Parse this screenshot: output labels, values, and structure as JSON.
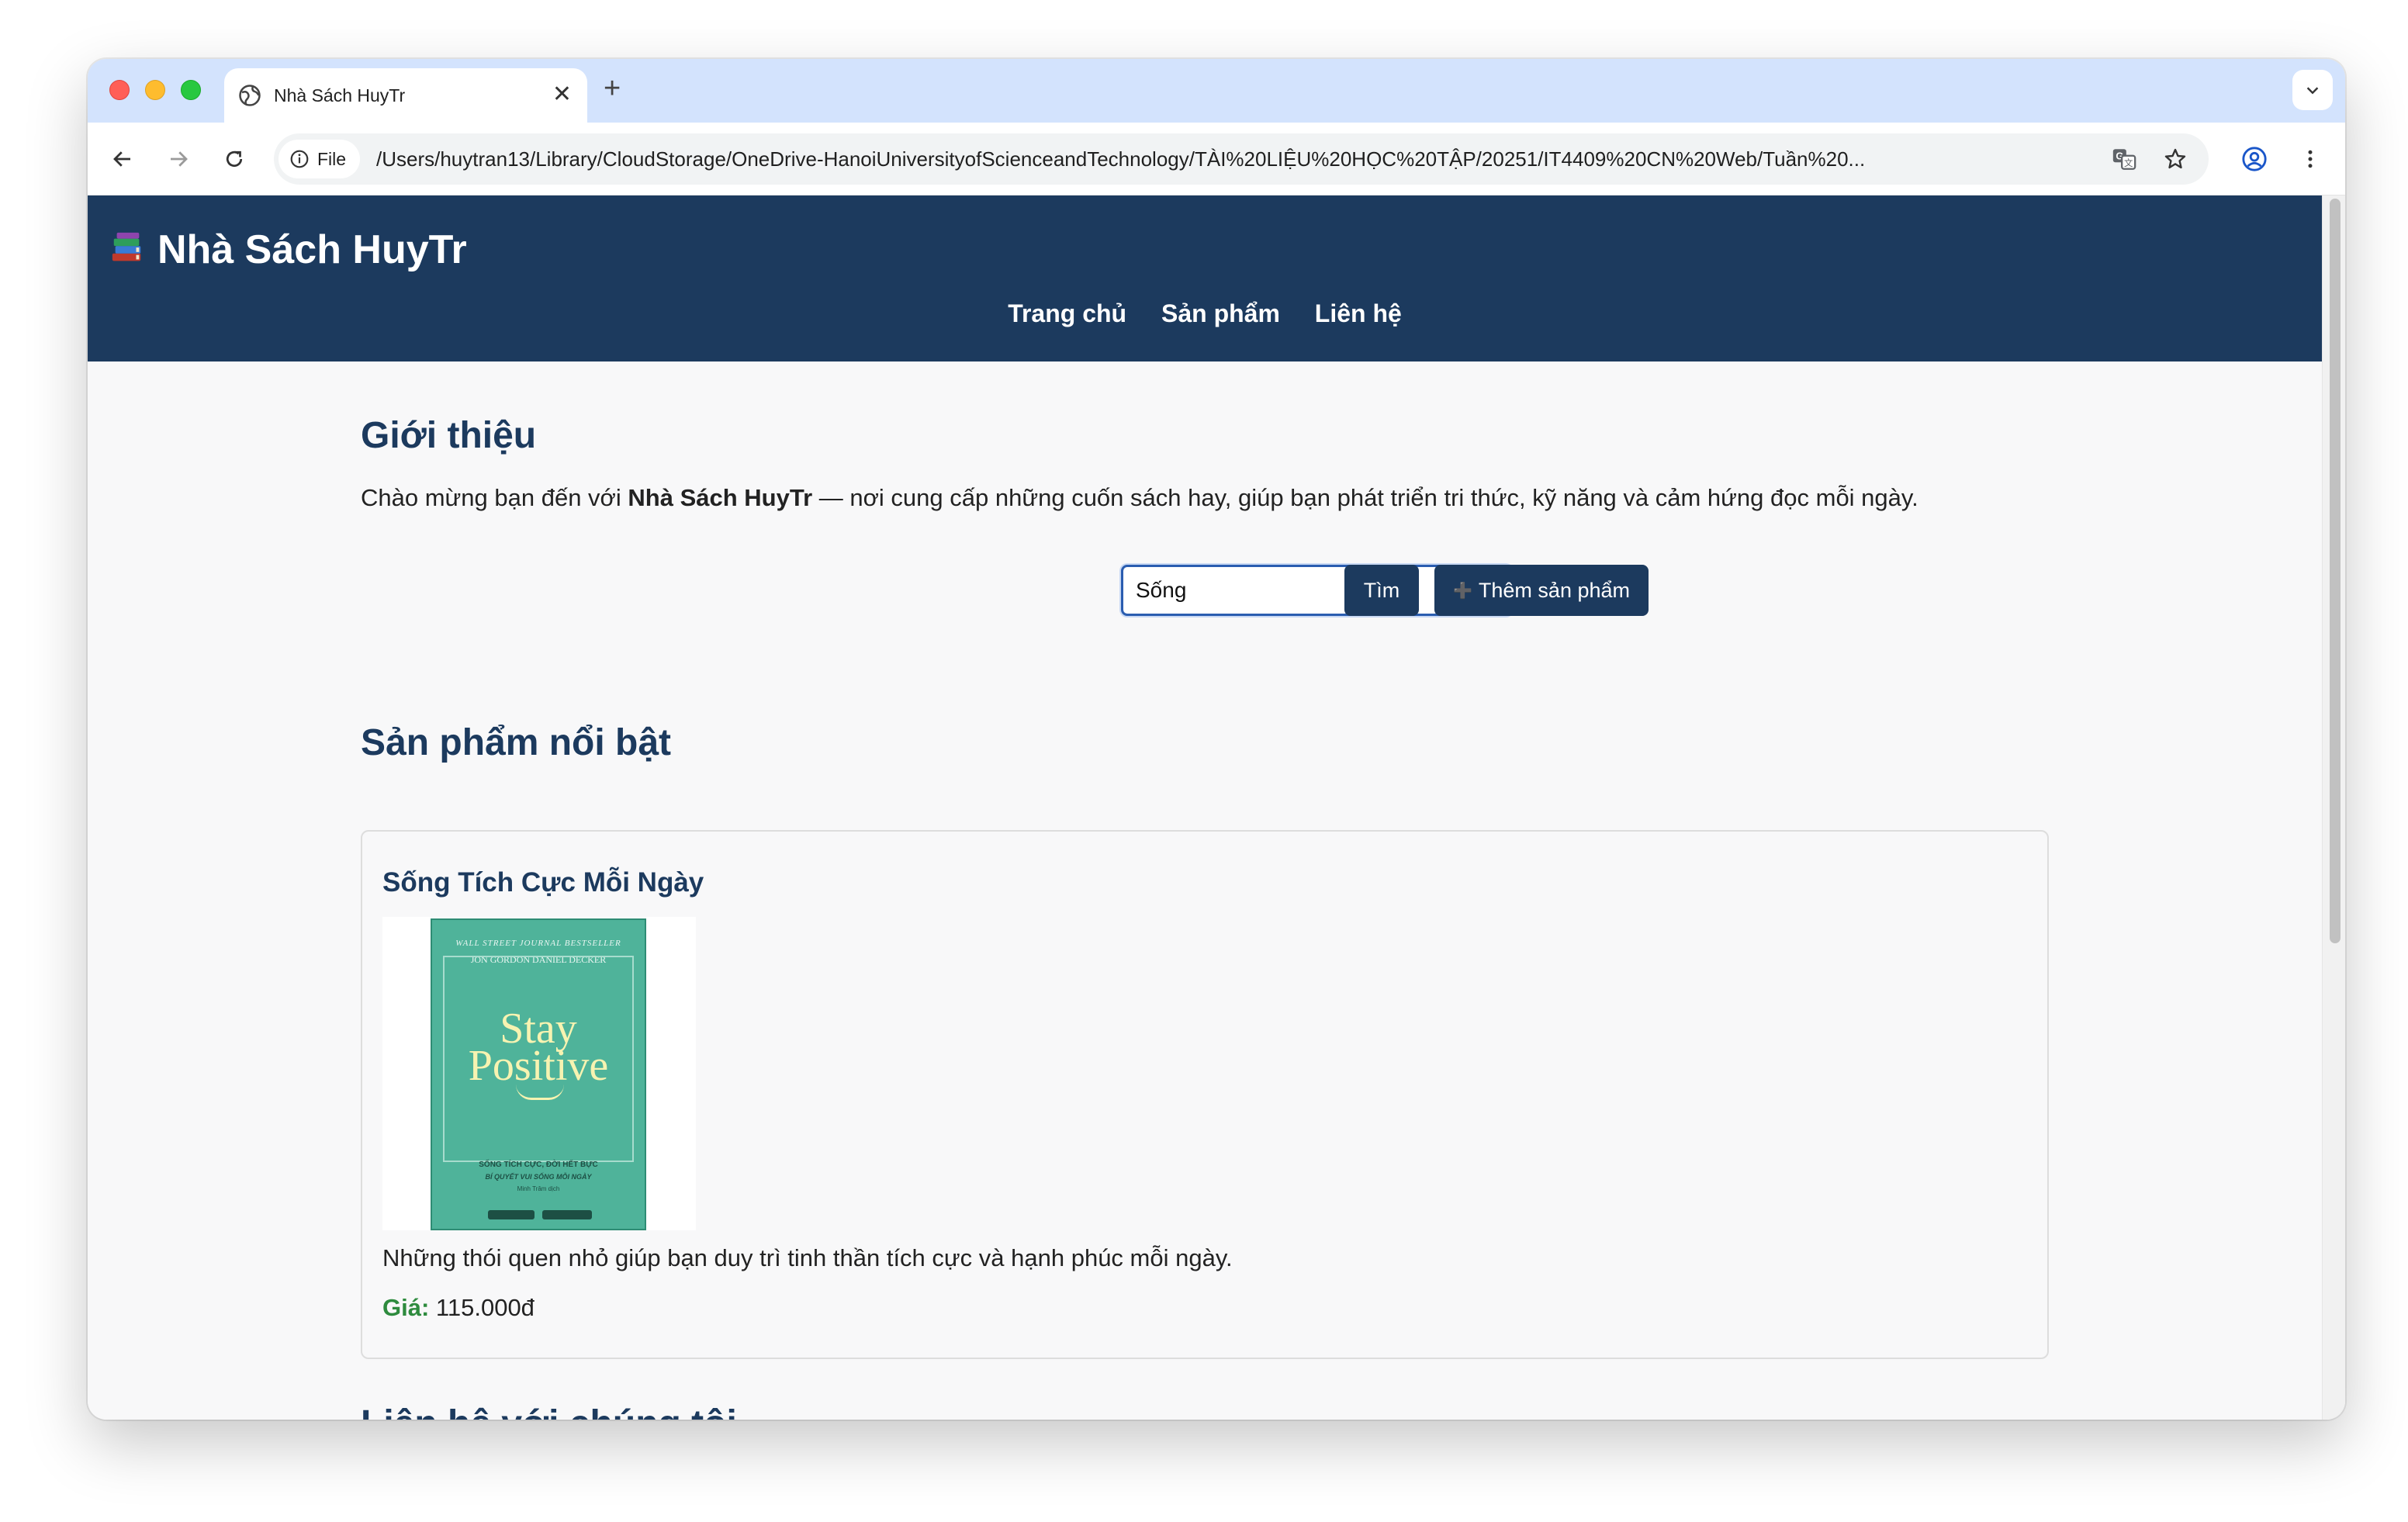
{
  "browser": {
    "tab_title": "Nhà Sách HuyTr",
    "close_glyph": "✕",
    "new_tab_glyph": "+",
    "chip_label": "File",
    "url": "/Users/huytran13/Library/CloudStorage/OneDrive-HanoiUniversityofScienceandTechnology/TÀI%20LIỆU%20HỌC%20TẬP/20251/IT4409%20CN%20Web/Tuần%20..."
  },
  "site": {
    "logo_text": "Nhà Sách HuyTr",
    "nav": [
      "Trang chủ",
      "Sản phẩm",
      "Liên hệ"
    ]
  },
  "intro": {
    "heading": "Giới thiệu",
    "text_before": "Chào mừng bạn đến với ",
    "text_bold": "Nhà Sách HuyTr",
    "text_after": " — nơi cung cấp những cuốn sách hay, giúp bạn phát triển tri thức, kỹ năng và cảm hứng đọc mỗi ngày."
  },
  "search": {
    "value": "Sống",
    "search_label": "Tìm",
    "add_icon": "➕",
    "add_label": "Thêm sản phẩm"
  },
  "featured": {
    "heading": "Sản phẩm nổi bật",
    "products": [
      {
        "title": "Sống Tích Cực Mỗi Ngày",
        "description": "Những thói quen nhỏ giúp bạn duy trì tinh thần tích cực và hạnh phúc mỗi ngày.",
        "price_label": "Giá:",
        "price": "115.000đ",
        "cover": {
          "top_line": "WALL STREET JOURNAL BESTSELLER",
          "authors": "JON GORDON    DANIEL DECKER",
          "title_line1": "Stay",
          "title_line2": "Positive",
          "sub1": "SỐNG TÍCH CỰC, ĐỜI HẾT BỰC",
          "sub2": "BÍ QUYẾT VUI SỐNG MỖI NGÀY",
          "sub3": "Minh Trâm dịch"
        }
      }
    ]
  },
  "contact": {
    "heading": "Liên hệ với chúng tôi"
  },
  "colors": {
    "header_bg": "#1c3a5e",
    "price_label": "#2e8b3e",
    "book_cover": "#4fb39a"
  }
}
